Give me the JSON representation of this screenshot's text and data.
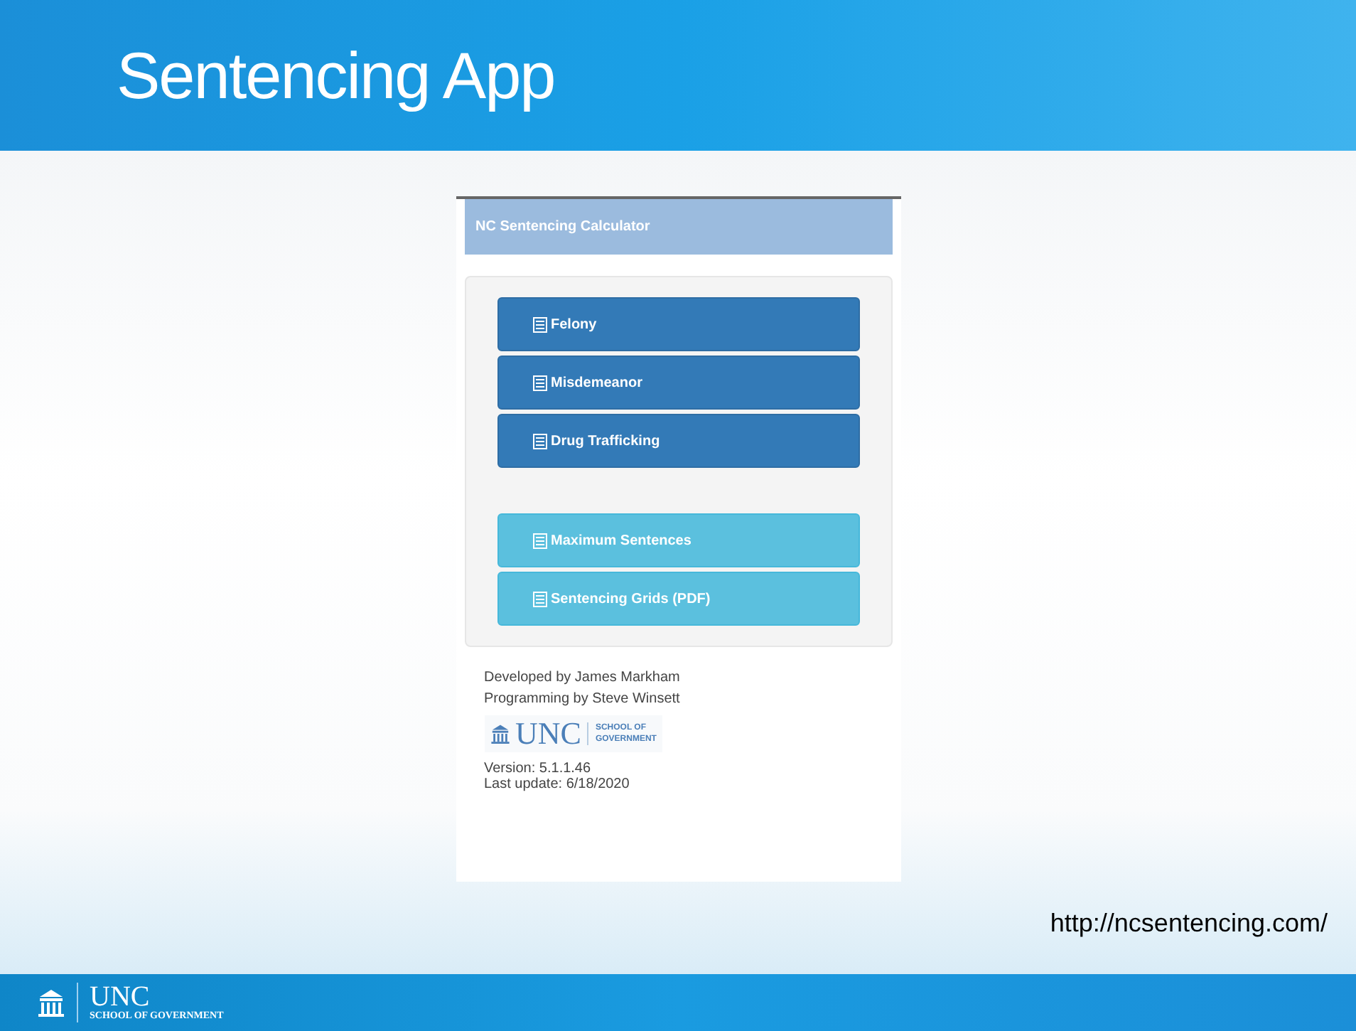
{
  "slide": {
    "title": "Sentencing App",
    "url": "http://ncsentencing.com/"
  },
  "app": {
    "header": "NC Sentencing Calculator",
    "buttons": [
      {
        "label": "Felony",
        "kind": "primary"
      },
      {
        "label": "Misdemeanor",
        "kind": "primary"
      },
      {
        "label": "Drug Trafficking",
        "kind": "primary"
      },
      {
        "label": "Maximum Sentences",
        "kind": "info"
      },
      {
        "label": "Sentencing Grids (PDF)",
        "kind": "info"
      }
    ],
    "credits": [
      "Developed by James Markham",
      "Programming by Steve Winsett"
    ],
    "logo": {
      "wordmark": "UNC",
      "subtitle_lines": [
        "SCHOOL OF",
        "GOVERNMENT"
      ]
    },
    "version": [
      "Version: 5.1.1.46",
      "Last update: 6/18/2020"
    ]
  },
  "footer": {
    "wordmark": "UNC",
    "subtitle": "SCHOOL OF GOVERNMENT"
  }
}
